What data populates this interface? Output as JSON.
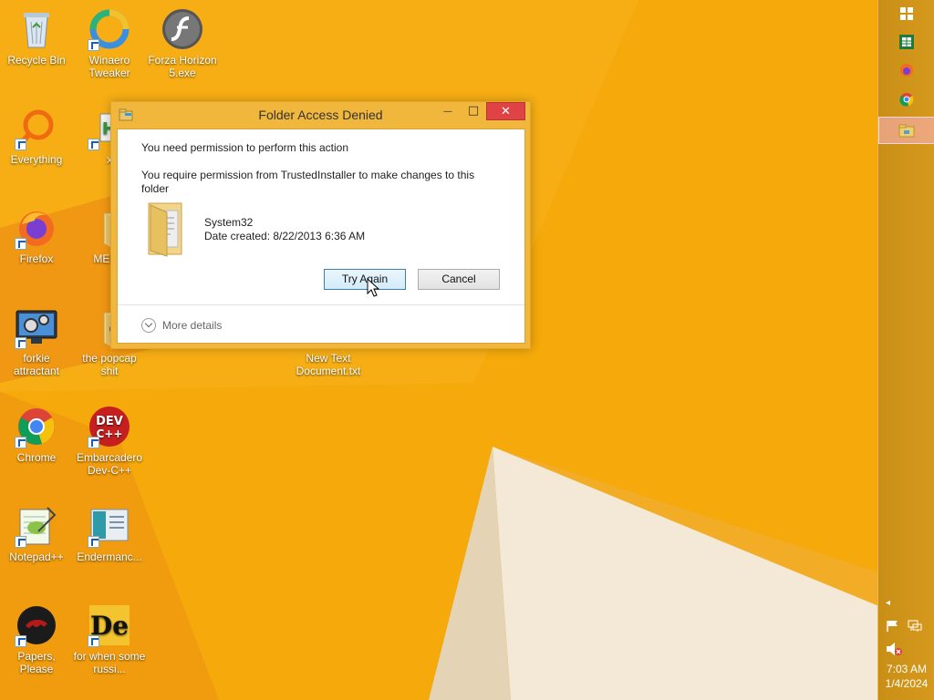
{
  "desktop": {
    "icons": [
      {
        "label": "Recycle Bin"
      },
      {
        "label": "Winaero Tweaker"
      },
      {
        "label": "Forza Horizon 5.exe"
      },
      {
        "label": "Everything"
      },
      {
        "label": "x"
      },
      {
        "label": "Firefox"
      },
      {
        "label": "MEMZ"
      },
      {
        "label": "forkie attractant"
      },
      {
        "label": "the popcap shit"
      },
      {
        "label": "New Text Document.txt"
      },
      {
        "label": "Chrome"
      },
      {
        "label": "Embarcadero Dev-C++"
      },
      {
        "label": "Notepad++"
      },
      {
        "label": "Endermanc..."
      },
      {
        "label": "Papers, Please"
      },
      {
        "label": "for when some russi..."
      }
    ]
  },
  "dialog": {
    "title": "Folder Access Denied",
    "heading": "You need permission to perform this action",
    "message": "You require permission from TrustedInstaller to make changes to this folder",
    "folder_name": "System32",
    "date_created": "Date created: 8/22/2013 6:36 AM",
    "try_again_label": "Try Again",
    "cancel_label": "Cancel",
    "more_details_label": "More details",
    "minimize_glyph": "—",
    "maximize_glyph": "□",
    "close_glyph": "✕"
  },
  "taskbar": {
    "items": [
      {
        "icon": "windows-start-icon"
      },
      {
        "icon": "excel-icon"
      },
      {
        "icon": "firefox-icon"
      },
      {
        "icon": "chrome-icon"
      },
      {
        "icon": "file-explorer-icon",
        "active": true
      }
    ],
    "tray": {
      "time": "7:03 AM",
      "date": "1/4/2024",
      "show_hidden_glyph": "◂"
    }
  },
  "colors": {
    "wallpaper": "#f5a90a",
    "dialog_frame": "#f0b73c",
    "close_button": "#e04343"
  }
}
